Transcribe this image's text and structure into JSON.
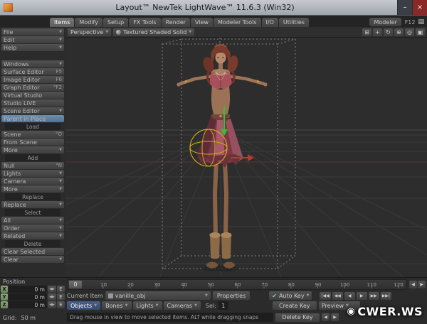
{
  "window": {
    "title": "Layout™ NewTek LightWave™ 11.6.3 (Win32)",
    "controls": {
      "minimize": "–",
      "close": "×"
    }
  },
  "tab_bar": {
    "tabs": [
      "Items",
      "Modify",
      "Setup",
      "FX Tools",
      "Render",
      "View",
      "Modeler Tools",
      "I/O",
      "Utilities"
    ],
    "selected": "Items",
    "modeler_button": "Modeler",
    "modeler_shortcut": "F12",
    "panel_icon": "▤"
  },
  "viewport_toolbar": {
    "view_mode": "Perspective",
    "shading_mode": "Textured Shaded Solid",
    "dropdown_arrow": "▼",
    "right_icons": [
      {
        "name": "grid-toggle-icon",
        "glyph": "⊞"
      },
      {
        "name": "pan-icon",
        "glyph": "+"
      },
      {
        "name": "rotate-icon",
        "glyph": "↻"
      },
      {
        "name": "zoom-icon",
        "glyph": "⊕"
      },
      {
        "name": "magnify-icon",
        "glyph": "◎"
      },
      {
        "name": "maximize-icon",
        "glyph": "▣"
      }
    ]
  },
  "sidebar": {
    "items": [
      {
        "type": "button",
        "label": "File",
        "arrow": true
      },
      {
        "type": "button",
        "label": "Edit",
        "arrow": true
      },
      {
        "type": "button",
        "label": "Help",
        "arrow": true
      },
      {
        "type": "gap"
      },
      {
        "type": "button",
        "label": "Windows",
        "arrow": true
      },
      {
        "type": "button",
        "label": "Surface Editor",
        "shortcut": "F5"
      },
      {
        "type": "button",
        "label": "Image Editor",
        "shortcut": "F6"
      },
      {
        "type": "button",
        "label": "Graph Editor",
        "shortcut": "°F2"
      },
      {
        "type": "button",
        "label": "Virtual Studio"
      },
      {
        "type": "button",
        "label": "Studio LIVE"
      },
      {
        "type": "button",
        "label": "Scene Editor",
        "arrow": true
      },
      {
        "type": "button",
        "label": "Parent in Place",
        "active": true
      },
      {
        "type": "section",
        "label": "Load"
      },
      {
        "type": "button",
        "label": "Scene",
        "shortcut": "°O"
      },
      {
        "type": "button",
        "label": "From Scene"
      },
      {
        "type": "button",
        "label": "More",
        "arrow": true
      },
      {
        "type": "section",
        "label": "Add"
      },
      {
        "type": "button",
        "label": "Null",
        "shortcut": "°N"
      },
      {
        "type": "button",
        "label": "Lights",
        "arrow": true
      },
      {
        "type": "button",
        "label": "Camera",
        "arrow": true
      },
      {
        "type": "button",
        "label": "More",
        "arrow": true
      },
      {
        "type": "section",
        "label": "Replace"
      },
      {
        "type": "button",
        "label": "Replace",
        "arrow": true
      },
      {
        "type": "section",
        "label": "Select"
      },
      {
        "type": "button",
        "label": "All",
        "arrow": true
      },
      {
        "type": "button",
        "label": "Order",
        "arrow": true
      },
      {
        "type": "button",
        "label": "Related",
        "arrow": true
      },
      {
        "type": "section",
        "label": "Delete"
      },
      {
        "type": "button",
        "label": "Clear Selected"
      },
      {
        "type": "button",
        "label": "Clear",
        "arrow": true
      }
    ]
  },
  "position_panel": {
    "title": "Position",
    "axes": [
      {
        "axis": "X",
        "value": "0 m"
      },
      {
        "axis": "Y",
        "value": "0 m"
      },
      {
        "axis": "Z",
        "value": "0 m"
      }
    ],
    "stepper_glyph": "◀▶",
    "envelope_label": "E",
    "grid_label": "Grid:",
    "grid_value": "50 m"
  },
  "timeline": {
    "ticks": [
      0,
      10,
      20,
      30,
      40,
      50,
      60,
      70,
      80,
      90,
      100,
      110,
      120
    ],
    "current_frame": "0",
    "steppers": [
      "◀",
      "▶"
    ]
  },
  "controls": {
    "current_item_label": "Current Item",
    "current_item_value": "vanille_obj",
    "properties_button": "Properties",
    "auto_key_label": "Auto Key",
    "auto_key_checked": true,
    "check_glyph": "✔",
    "transport": [
      "|◀◀",
      "◀◀",
      "◀",
      "▶",
      "▶▶",
      "▶▶|"
    ],
    "transport_names": [
      "go-to-start",
      "previous-keyframe",
      "previous-frame",
      "next-frame",
      "next-keyframe",
      "go-to-end"
    ],
    "edit_modes": [
      "Objects",
      "Bones",
      "Lights",
      "Cameras"
    ],
    "selected_mode": "Objects",
    "sel_label": "Sel:",
    "sel_value": "1",
    "create_key_button": "Create Key",
    "delete_key_button": "Delete Key",
    "preview_button": "Preview",
    "preview_steppers": [
      "◀",
      "▶"
    ],
    "status_text": "Drag mouse in view to move selected items. ALT while dragging snaps"
  },
  "watermark": {
    "logo": "◉",
    "text": "CWER.WS"
  },
  "colors": {
    "accent_active": "#50719e",
    "axis_x": "#c23434",
    "axis_y": "#35c035",
    "handle_yellow": "#d0a818",
    "watermark": "#ffffff"
  }
}
